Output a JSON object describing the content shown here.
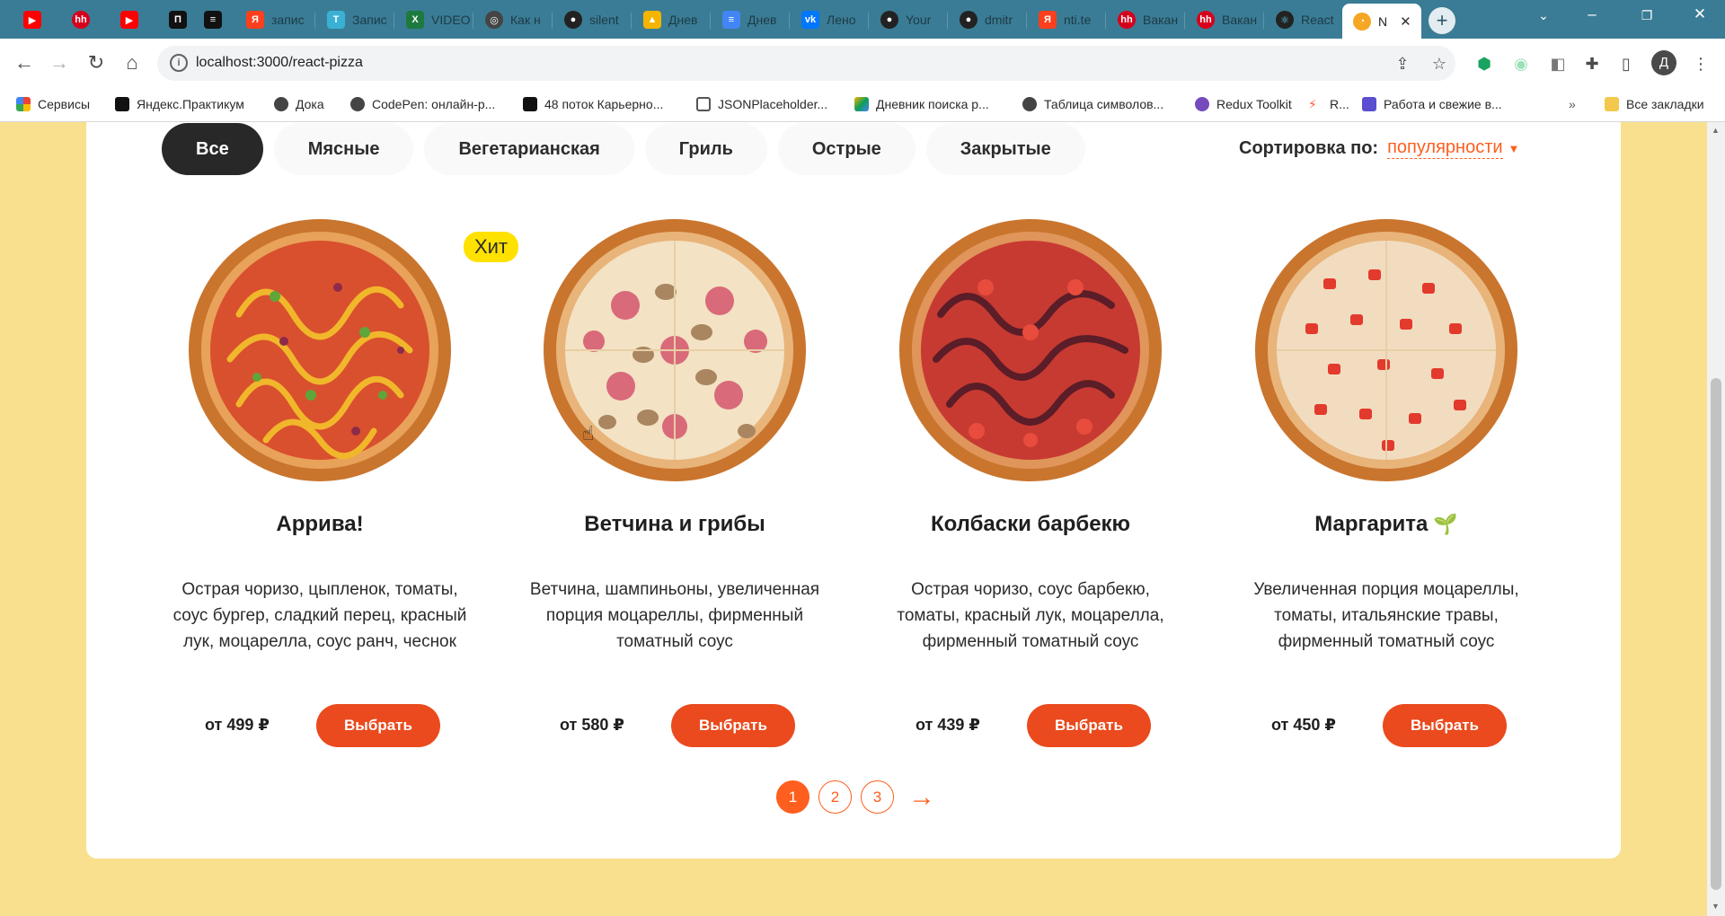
{
  "browser": {
    "tabs": [
      {
        "label": "",
        "icon": "youtube-icon",
        "color": "#ff0000"
      },
      {
        "label": "",
        "icon": "hh-icon",
        "color": "#d6001c"
      },
      {
        "label": "",
        "icon": "youtube-icon",
        "color": "#ff0000"
      },
      {
        "label": "",
        "icon": "practicum-icon",
        "color": "#111111"
      },
      {
        "label": "",
        "icon": "stack-icon",
        "color": "#111111"
      },
      {
        "label": "запис",
        "icon": "yandex-icon",
        "color": "#fc3f1d"
      },
      {
        "label": "Запис",
        "icon": "telegraph-icon",
        "color": "#3ab0d5"
      },
      {
        "label": "VIDEO",
        "icon": "excel-icon",
        "color": "#1d7a3e"
      },
      {
        "label": "Как н",
        "icon": "globe-icon",
        "color": "#444444"
      },
      {
        "label": "silent",
        "icon": "github-icon",
        "color": "#222222"
      },
      {
        "label": "Днев",
        "icon": "drive-icon",
        "color": "#f4b400"
      },
      {
        "label": "Днев",
        "icon": "docs-icon",
        "color": "#4285f4"
      },
      {
        "label": "Лено",
        "icon": "vk-icon",
        "color": "#0077ff"
      },
      {
        "label": "Your",
        "icon": "github-icon",
        "color": "#222222"
      },
      {
        "label": "dmitr",
        "icon": "github-icon",
        "color": "#222222"
      },
      {
        "label": "nti.te",
        "icon": "yandex-icon",
        "color": "#fc3f1d"
      },
      {
        "label": "Вакан",
        "icon": "hh-icon",
        "color": "#d6001c"
      },
      {
        "label": "Вакан",
        "icon": "hh-icon",
        "color": "#d6001c"
      },
      {
        "label": "React",
        "icon": "react-icon",
        "color": "#222222"
      },
      {
        "label": "N",
        "icon": "pizza-icon",
        "color": "#f5a623",
        "active": true
      }
    ],
    "url": "localhost:3000/react-pizza",
    "bookmarks": [
      {
        "label": "Сервисы",
        "icon": "apps-grid-icon",
        "color": "#ea4335"
      },
      {
        "label": "Яндекс.Практикум",
        "icon": "practicum-icon",
        "color": "#111111"
      },
      {
        "label": "Дока",
        "icon": "globe-icon",
        "color": "#444444"
      },
      {
        "label": "CodePen: онлайн-р...",
        "icon": "globe-icon",
        "color": "#444444"
      },
      {
        "label": "48 поток Карьерно...",
        "icon": "stack-icon",
        "color": "#111111"
      },
      {
        "label": "JSONPlaceholder...",
        "icon": "json-icon",
        "color": "#555555"
      },
      {
        "label": "Дневник поиска р...",
        "icon": "drive-icon",
        "color": "#f4b400"
      },
      {
        "label": "Таблица символов...",
        "icon": "globe-icon",
        "color": "#444444"
      },
      {
        "label": "Redux Toolkit",
        "icon": "redux-icon",
        "color": "#764abc"
      },
      {
        "label": "R...",
        "icon": "bolt-icon",
        "color": "#ff5a36"
      },
      {
        "label": "Работа и свежие в...",
        "icon": "job-icon",
        "color": "#5b4ed1"
      },
      {
        "label": "Все закладки",
        "icon": "folder-icon",
        "color": "#f2c94c"
      }
    ],
    "profile_initial": "Д"
  },
  "categories": [
    {
      "label": "Все",
      "active": true
    },
    {
      "label": "Мясные"
    },
    {
      "label": "Вегетарианская"
    },
    {
      "label": "Гриль"
    },
    {
      "label": "Острые"
    },
    {
      "label": "Закрытые"
    }
  ],
  "sort": {
    "label": "Сортировка по:",
    "value": "популярности"
  },
  "pizzas": [
    {
      "title": "Аррива!",
      "desc": "Острая чоризо, цыпленок, томаты, соус бургер, сладкий перец, красный лук, моцарелла, соус ранч, чеснок",
      "price": "от 499 ₽",
      "badge": "Хит",
      "button": "Выбрать"
    },
    {
      "title": "Ветчина и грибы",
      "desc": "Ветчина, шампиньоны, увеличенная порция моцареллы, фирменный томатный соус",
      "price": "от 580 ₽",
      "button": "Выбрать"
    },
    {
      "title": "Колбаски барбекю",
      "desc": "Острая чоризо, соус барбекю, томаты, красный лук, моцарелла, фирменный томатный соус",
      "price": "от 439 ₽",
      "button": "Выбрать"
    },
    {
      "title": "Маргарита",
      "desc": "Увеличенная порция моцареллы, томаты, итальянские травы, фирменный томатный соус",
      "price": "от 450 ₽",
      "button": "Выбрать",
      "vegetarian": true
    }
  ],
  "pagination": {
    "pages": [
      "1",
      "2",
      "3"
    ],
    "current": "1"
  }
}
